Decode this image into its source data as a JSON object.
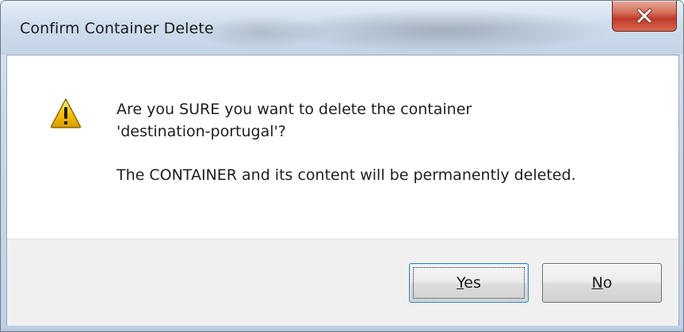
{
  "window": {
    "title": "Confirm Container Delete",
    "close_glyph": "x"
  },
  "icons": {
    "close": "close-icon",
    "warning": "warning-icon"
  },
  "message": {
    "line1": "Are you SURE you want to delete the container",
    "line2": "'destination-portugal'?",
    "line3": "The CONTAINER and its content will be permanently deleted."
  },
  "buttons": {
    "yes": {
      "mnemonic": "Y",
      "rest": "es"
    },
    "no": {
      "mnemonic": "N",
      "rest": "o"
    }
  },
  "colors": {
    "close_button_red": "#c0392b",
    "warning_yellow": "#f5c400",
    "default_button_border": "#3c7fb1"
  }
}
